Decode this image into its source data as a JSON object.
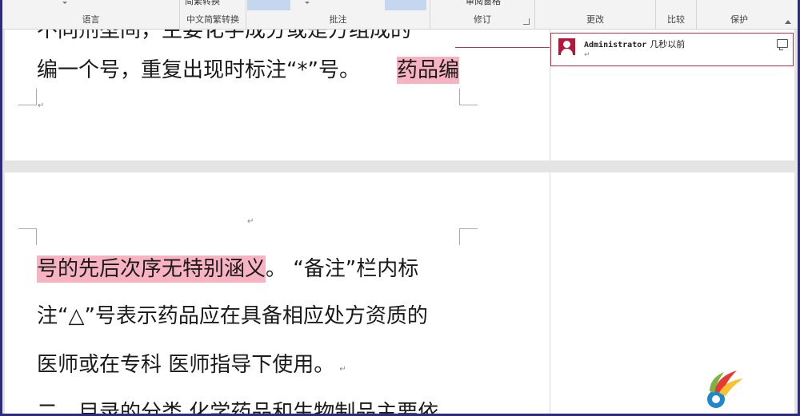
{
  "ribbon": {
    "groups": {
      "language": "语言",
      "chinese_conversion": "中文简繁转换",
      "comments": "批注",
      "tracking": "修订",
      "changes": "更改",
      "compare": "比较",
      "protect": "保护"
    },
    "cut_text_1": "简繁转换",
    "cut_text_2": "审阅窗格"
  },
  "document": {
    "page1_line1": "不同剂型间，主要化学成分或是方组成的",
    "page1_line2": "编一个号，重复出现时标注“*”号。",
    "page1_highlight": "药品编",
    "page2_line1_highlight": "号的先后次序无特别涵义",
    "page2_line1_rest": "。   “备注”栏内标",
    "page2_line2": "注“△”号表示药品应在具备相应处方资质的",
    "page2_line3": "医师或在专科   医师指导下使用。",
    "page2_line4": "二、目录的分类    化学药品和生物制品主要依",
    "para_mark": "↵"
  },
  "comment": {
    "author": "Administrator",
    "time": "几秒以前",
    "para_mark": "↵"
  },
  "colors": {
    "highlight": "#f7b3c2",
    "comment_border": "#c0304a",
    "avatar": "#b5163b"
  }
}
